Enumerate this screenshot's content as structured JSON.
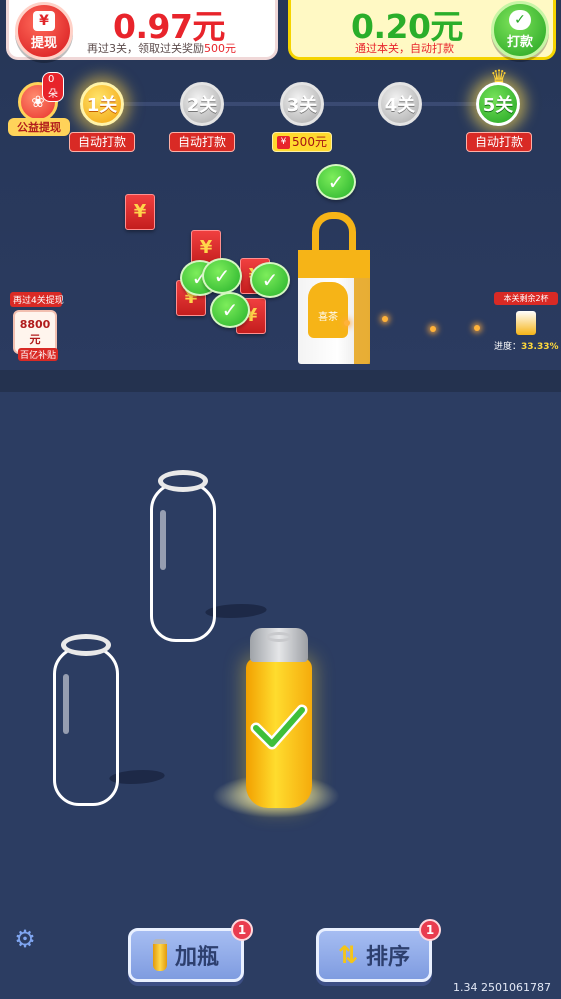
{
  "header": {
    "withdraw": {
      "button_label": "提现",
      "amount": "0.97元",
      "subtitle_prefix": "再过3关，领取过关奖励",
      "subtitle_accent": "500元",
      "icon": "yen-icon"
    },
    "pay": {
      "button_label": "打款",
      "amount": "0.20元",
      "subtitle": "通过本关，自动打款",
      "icon": "wechat-check-icon"
    }
  },
  "charity": {
    "badge": "0朵",
    "label": "公益提现"
  },
  "levels": [
    {
      "label": "1关",
      "status": "current",
      "tag": "自动打款"
    },
    {
      "label": "2关",
      "status": "locked",
      "tag": "自动打款"
    },
    {
      "label": "3关",
      "status": "locked",
      "tag": "500元"
    },
    {
      "label": "4关",
      "status": "locked",
      "tag": ""
    },
    {
      "label": "5关",
      "status": "final",
      "tag": "自动打款"
    }
  ],
  "scene": {
    "envelope_symbol": "¥",
    "bag_brand": "喜茶",
    "left_promo": {
      "tag": "再过4关提现",
      "amount": "8800元",
      "foot": "百亿补贴"
    },
    "right_progress": {
      "tag": "本关剩余2杯",
      "label": "进度：",
      "percent": "33.33%"
    }
  },
  "toolbar": {
    "add_bottle_label": "加瓶",
    "add_bottle_badge": "1",
    "sort_label": "排序",
    "sort_badge": "1",
    "sort_icon": "⇅"
  },
  "footer": {
    "version": "1.34 2501061787"
  },
  "colors": {
    "background": "#2c3d62",
    "accent_red": "#e8242b",
    "accent_green": "#2aae2a",
    "accent_gold": "#f6b417"
  }
}
